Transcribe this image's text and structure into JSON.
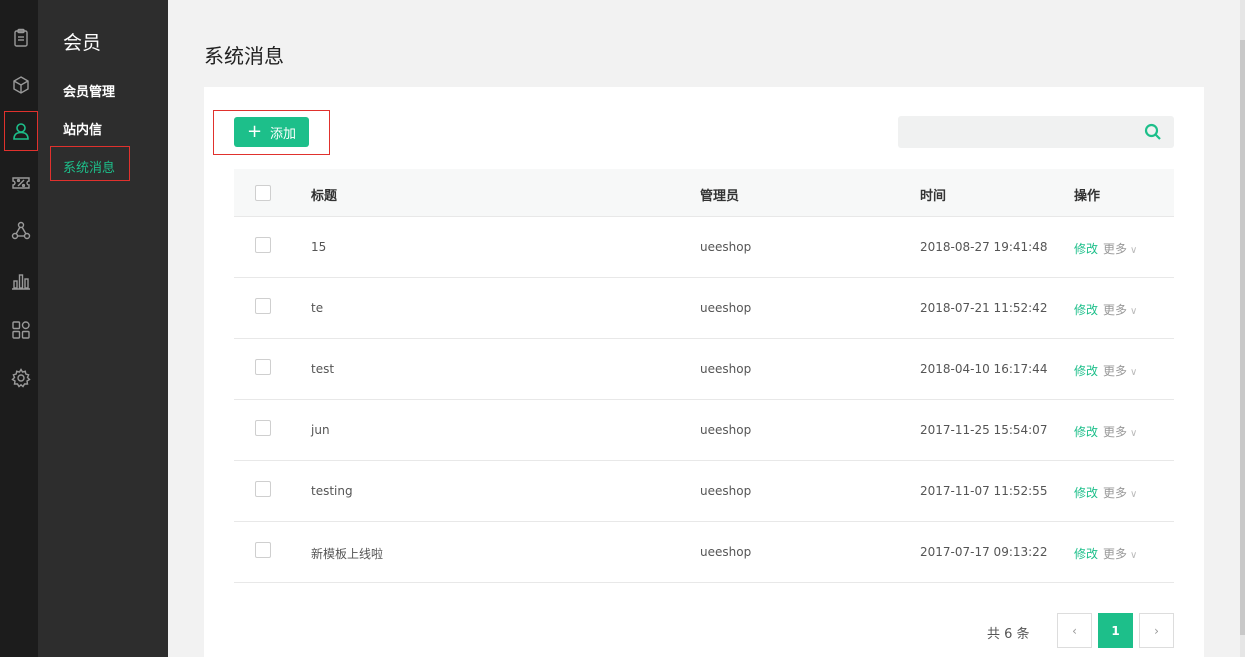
{
  "rail": {
    "icons": [
      "clipboard-icon",
      "box-icon",
      "member-icon",
      "percent-icon",
      "share-icon",
      "bar-chart-icon",
      "apps-icon",
      "gear-icon"
    ],
    "active": "member-icon",
    "accent": "#1dbf8a"
  },
  "submenu": {
    "title": "会员",
    "items": [
      {
        "label": "会员管理"
      },
      {
        "label": "站内信"
      },
      {
        "label": "系统消息"
      }
    ]
  },
  "page": {
    "title": "系统消息"
  },
  "toolbar": {
    "add_label": "添加",
    "search_placeholder": ""
  },
  "table": {
    "headers": {
      "title": "标题",
      "admin": "管理员",
      "time": "时间",
      "action": "操作"
    },
    "rows": [
      {
        "title": "15",
        "admin": "ueeshop",
        "time": "2018-08-27 19:41:48",
        "edit": "修改",
        "more": "更多"
      },
      {
        "title": "te",
        "admin": "ueeshop",
        "time": "2018-07-21 11:52:42",
        "edit": "修改",
        "more": "更多"
      },
      {
        "title": "test",
        "admin": "ueeshop",
        "time": "2018-04-10 16:17:44",
        "edit": "修改",
        "more": "更多"
      },
      {
        "title": "jun",
        "admin": "ueeshop",
        "time": "2017-11-25 15:54:07",
        "edit": "修改",
        "more": "更多"
      },
      {
        "title": "testing",
        "admin": "ueeshop",
        "time": "2017-11-07 11:52:55",
        "edit": "修改",
        "more": "更多"
      },
      {
        "title": "新模板上线啦",
        "admin": "ueeshop",
        "time": "2017-07-17 09:13:22",
        "edit": "修改",
        "more": "更多"
      }
    ]
  },
  "pagination": {
    "total_text": "共 6 条",
    "prev": "‹",
    "current": "1",
    "next": "›"
  }
}
